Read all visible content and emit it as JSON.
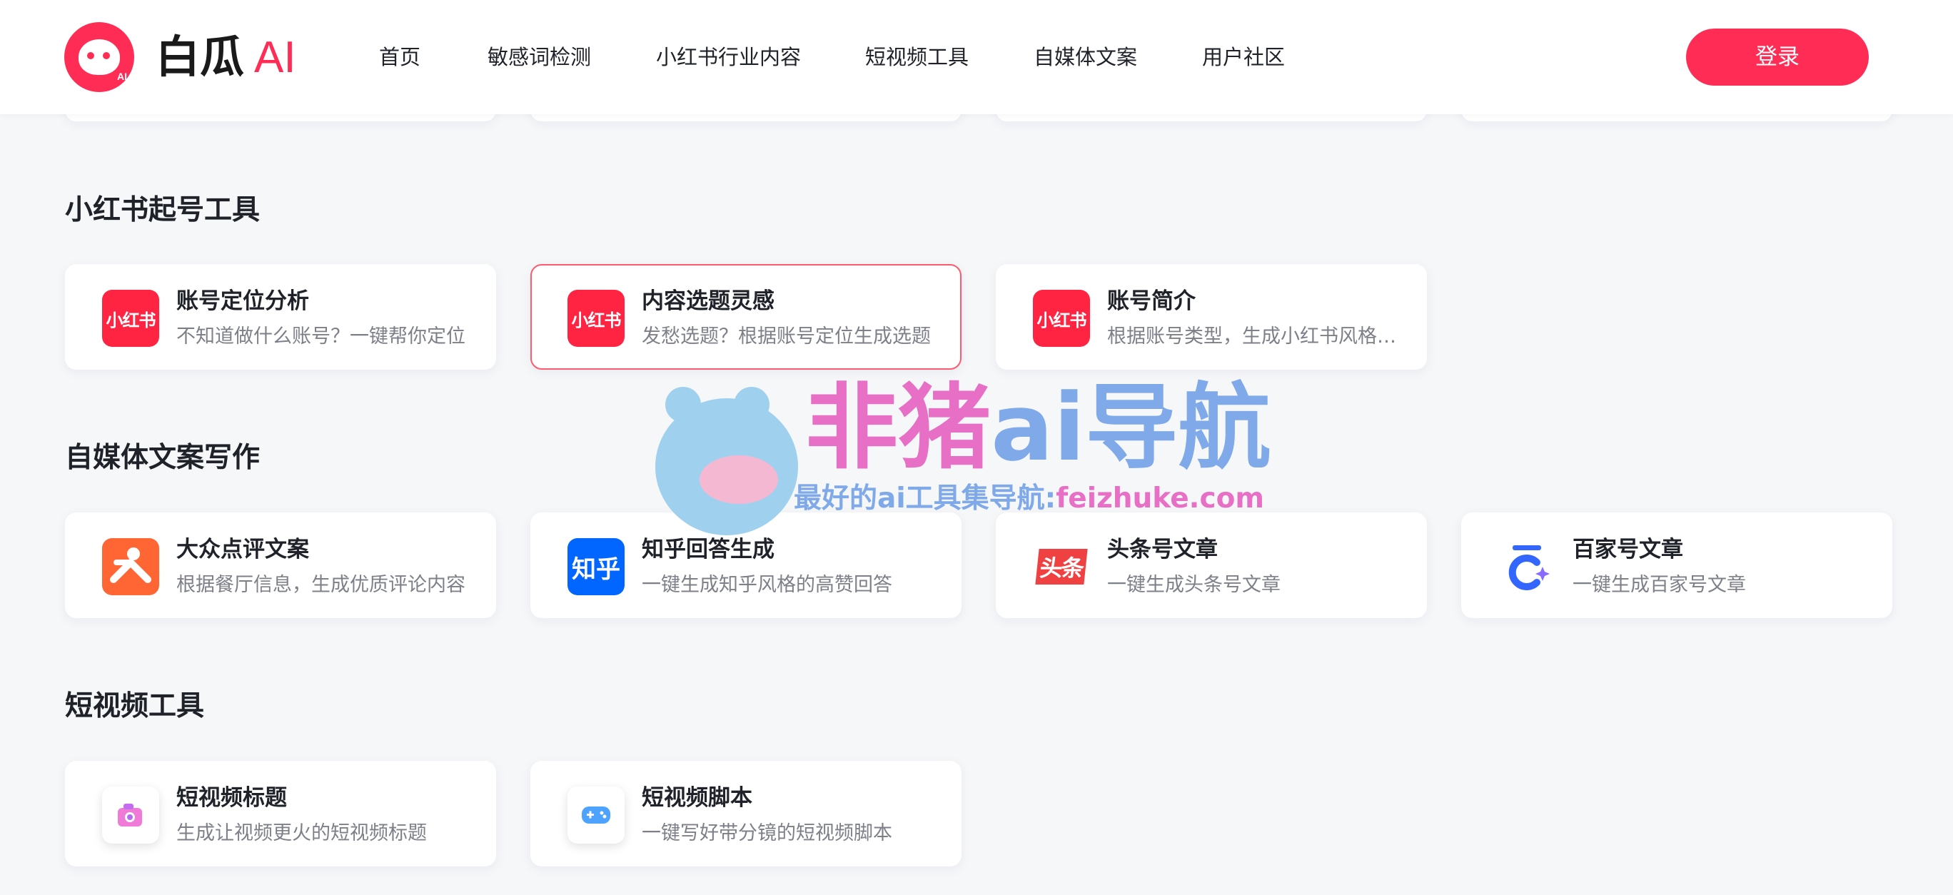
{
  "header": {
    "logo_text": "白瓜",
    "logo_ai": "AI",
    "logo_badge": "AI",
    "nav": [
      "首页",
      "敏感词检测",
      "小红书行业内容",
      "短视频工具",
      "自媒体文案",
      "用户社区"
    ],
    "login_label": "登录"
  },
  "sections": [
    {
      "title": "小红书起号工具",
      "cards": [
        {
          "icon": "xiaohongshu-icon",
          "icon_text": "小红书",
          "title": "账号定位分析",
          "desc": "不知道做什么账号？一键帮你定位"
        },
        {
          "icon": "xiaohongshu-icon",
          "icon_text": "小红书",
          "title": "内容选题灵感",
          "desc": "发愁选题？根据账号定位生成选题",
          "active": true
        },
        {
          "icon": "xiaohongshu-icon",
          "icon_text": "小红书",
          "title": "账号简介",
          "desc": "根据账号类型，生成小红书风格的账号简介"
        }
      ]
    },
    {
      "title": "自媒体文案写作",
      "cards": [
        {
          "icon": "dianping-icon",
          "title": "大众点评文案",
          "desc": "根据餐厅信息，生成优质评论内容"
        },
        {
          "icon": "zhihu-icon",
          "icon_text": "知乎",
          "title": "知乎回答生成",
          "desc": "一键生成知乎风格的高赞回答"
        },
        {
          "icon": "toutiao-icon",
          "icon_text": "头条",
          "title": "头条号文章",
          "desc": "一键生成头条号文章"
        },
        {
          "icon": "baijiahao-icon",
          "title": "百家号文章",
          "desc": "一键生成百家号文章"
        }
      ]
    },
    {
      "title": "短视频工具",
      "cards": [
        {
          "icon": "camera-icon",
          "title": "短视频标题",
          "desc": "生成让视频更火的短视频标题"
        },
        {
          "icon": "gamepad-icon",
          "title": "短视频脚本",
          "desc": "一键写好带分镜的短视频脚本"
        }
      ]
    }
  ],
  "watermark": {
    "title_pink": "非猪",
    "title_blue": "ai导航",
    "subtitle_blue": "最好的ai工具集导航:",
    "subtitle_pink": "feizhuke.com"
  },
  "colors": {
    "brand": "#ff2d55",
    "xiaohongshu": "#ff2442",
    "dianping": "#ff6633",
    "zhihu": "#0066ff",
    "toutiao": "#f04142",
    "active_border": "#ff5b6e"
  }
}
